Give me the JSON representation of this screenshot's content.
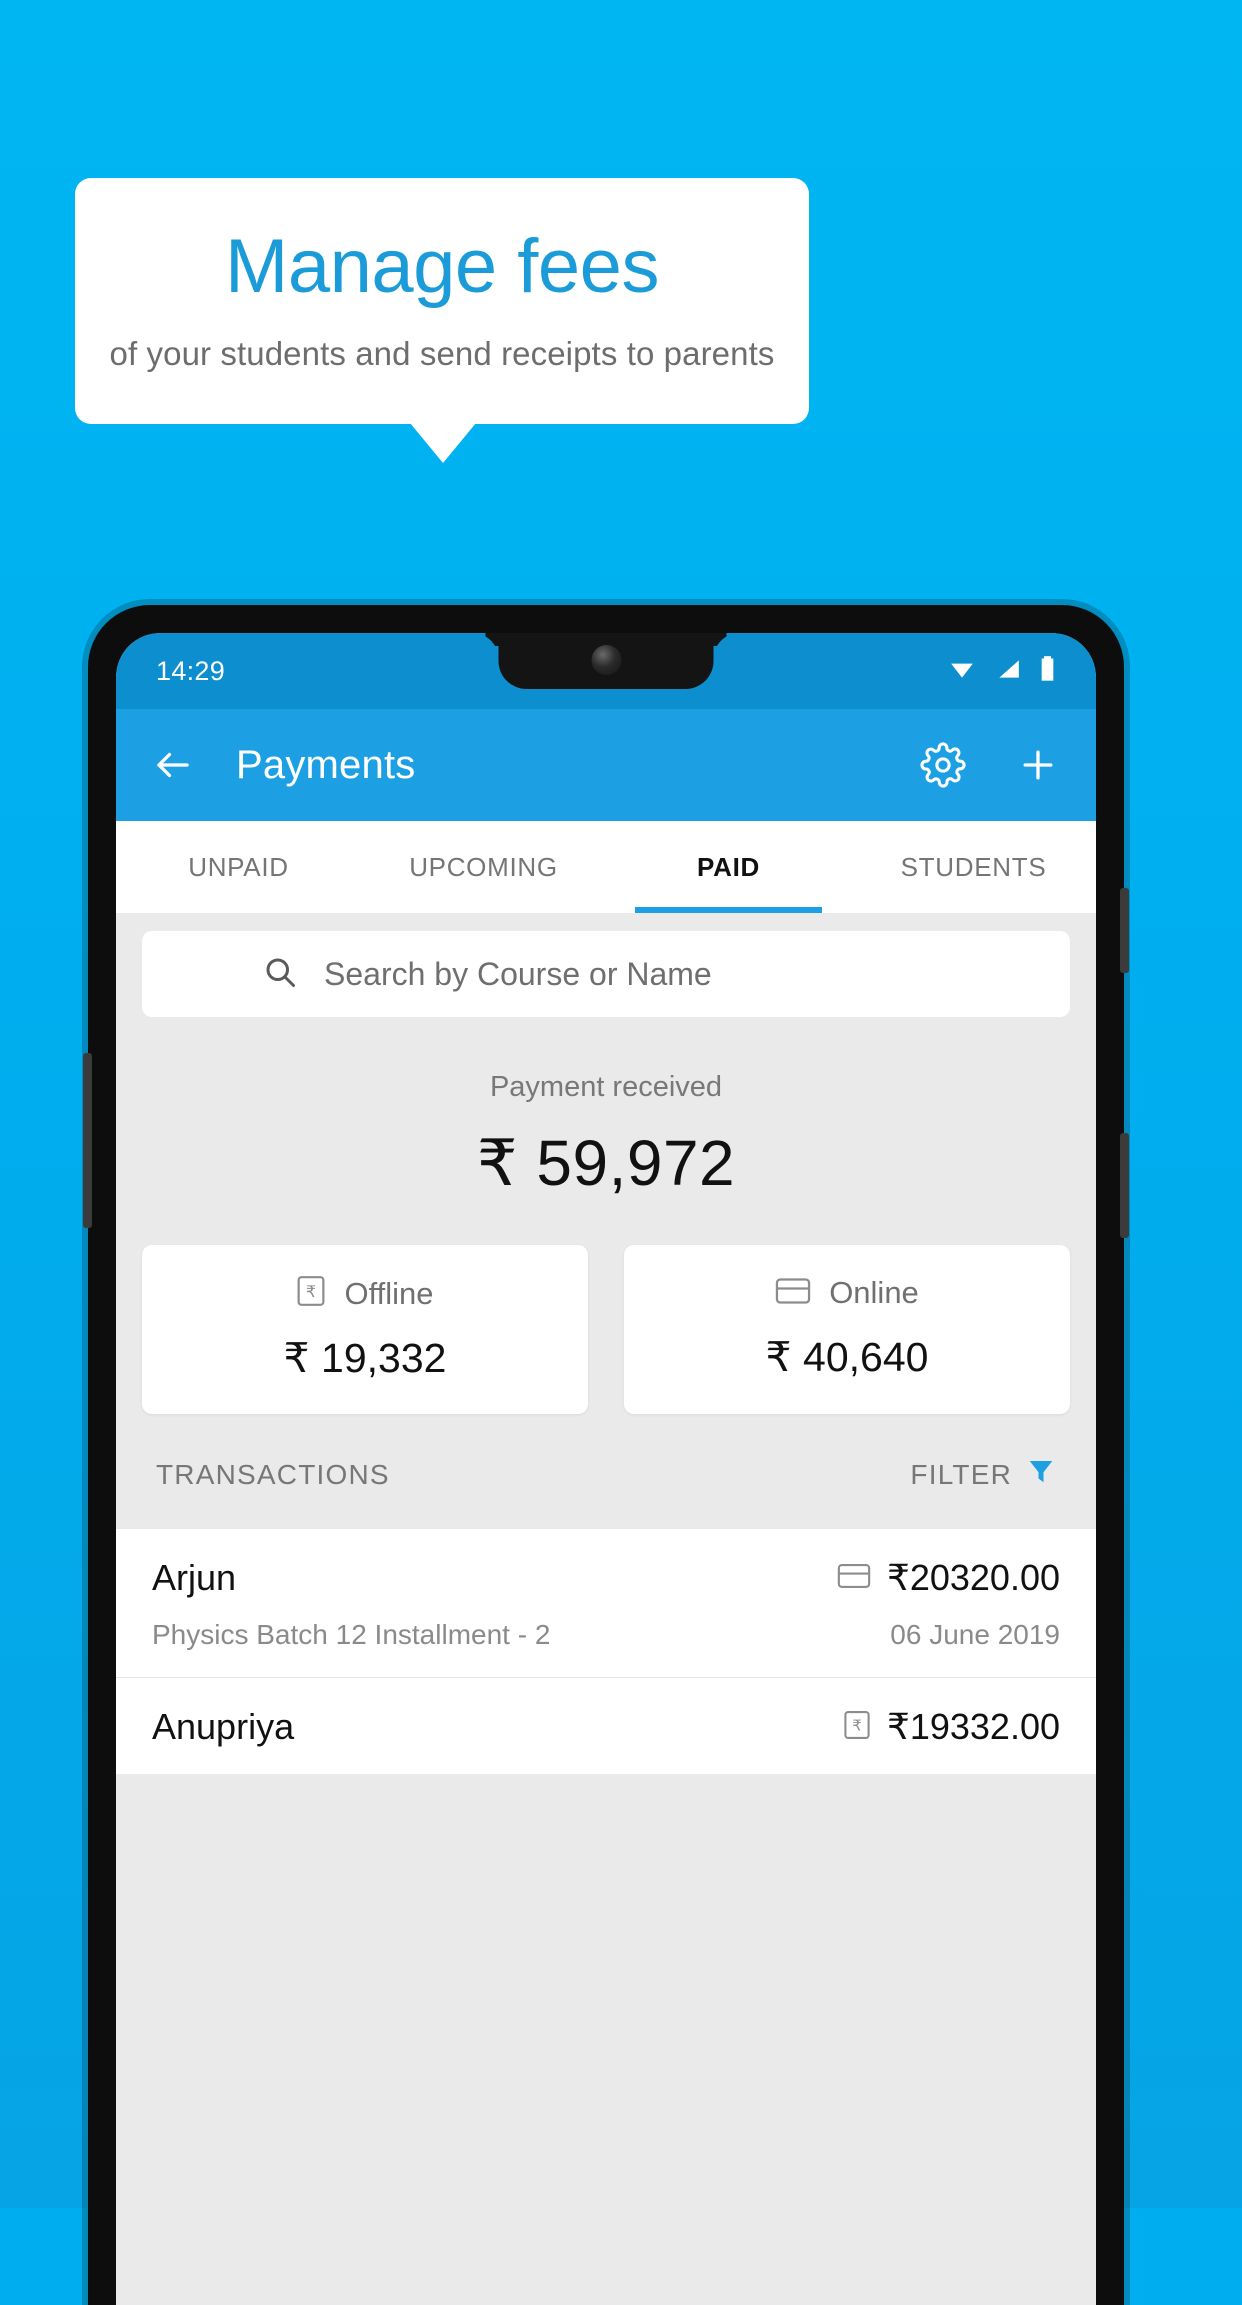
{
  "promo": {
    "title": "Manage fees",
    "subtitle": "of your students and send receipts to parents",
    "title_color": "#1b9bd8",
    "background_color": "#00aeef"
  },
  "phone": {
    "statusbar": {
      "time": "14:29",
      "icons": [
        "wifi-icon",
        "signal-icon",
        "battery-icon"
      ]
    },
    "appbar": {
      "back_icon": "back-arrow-icon",
      "title": "Payments",
      "settings_icon": "gear-icon",
      "add_icon": "plus-icon",
      "color": "#1ca0e3"
    },
    "tabs": [
      {
        "label": "UNPAID",
        "active": false
      },
      {
        "label": "UPCOMING",
        "active": false
      },
      {
        "label": "PAID",
        "active": true
      },
      {
        "label": "STUDENTS",
        "active": false
      }
    ],
    "search": {
      "icon": "search-icon",
      "placeholder": "Search by Course or Name",
      "value": ""
    },
    "summary": {
      "label": "Payment received",
      "amount": "₹ 59,972"
    },
    "methods": [
      {
        "icon": "rupee-note-icon",
        "name": "Offline",
        "amount": "₹ 19,332"
      },
      {
        "icon": "credit-card-icon",
        "name": "Online",
        "amount": "₹ 40,640"
      }
    ],
    "transactions_header": {
      "title": "TRANSACTIONS",
      "filter_label": "FILTER",
      "filter_icon": "funnel-icon",
      "filter_icon_color": "#1ca0e3"
    },
    "transactions": [
      {
        "name": "Arjun",
        "description": "Physics Batch 12 Installment - 2",
        "amount": "₹20320.00",
        "date": "06 June 2019",
        "method_icon": "credit-card-icon"
      },
      {
        "name": "Anupriya",
        "description": "",
        "amount": "₹19332.00",
        "date": "",
        "method_icon": "rupee-note-icon"
      }
    ]
  }
}
